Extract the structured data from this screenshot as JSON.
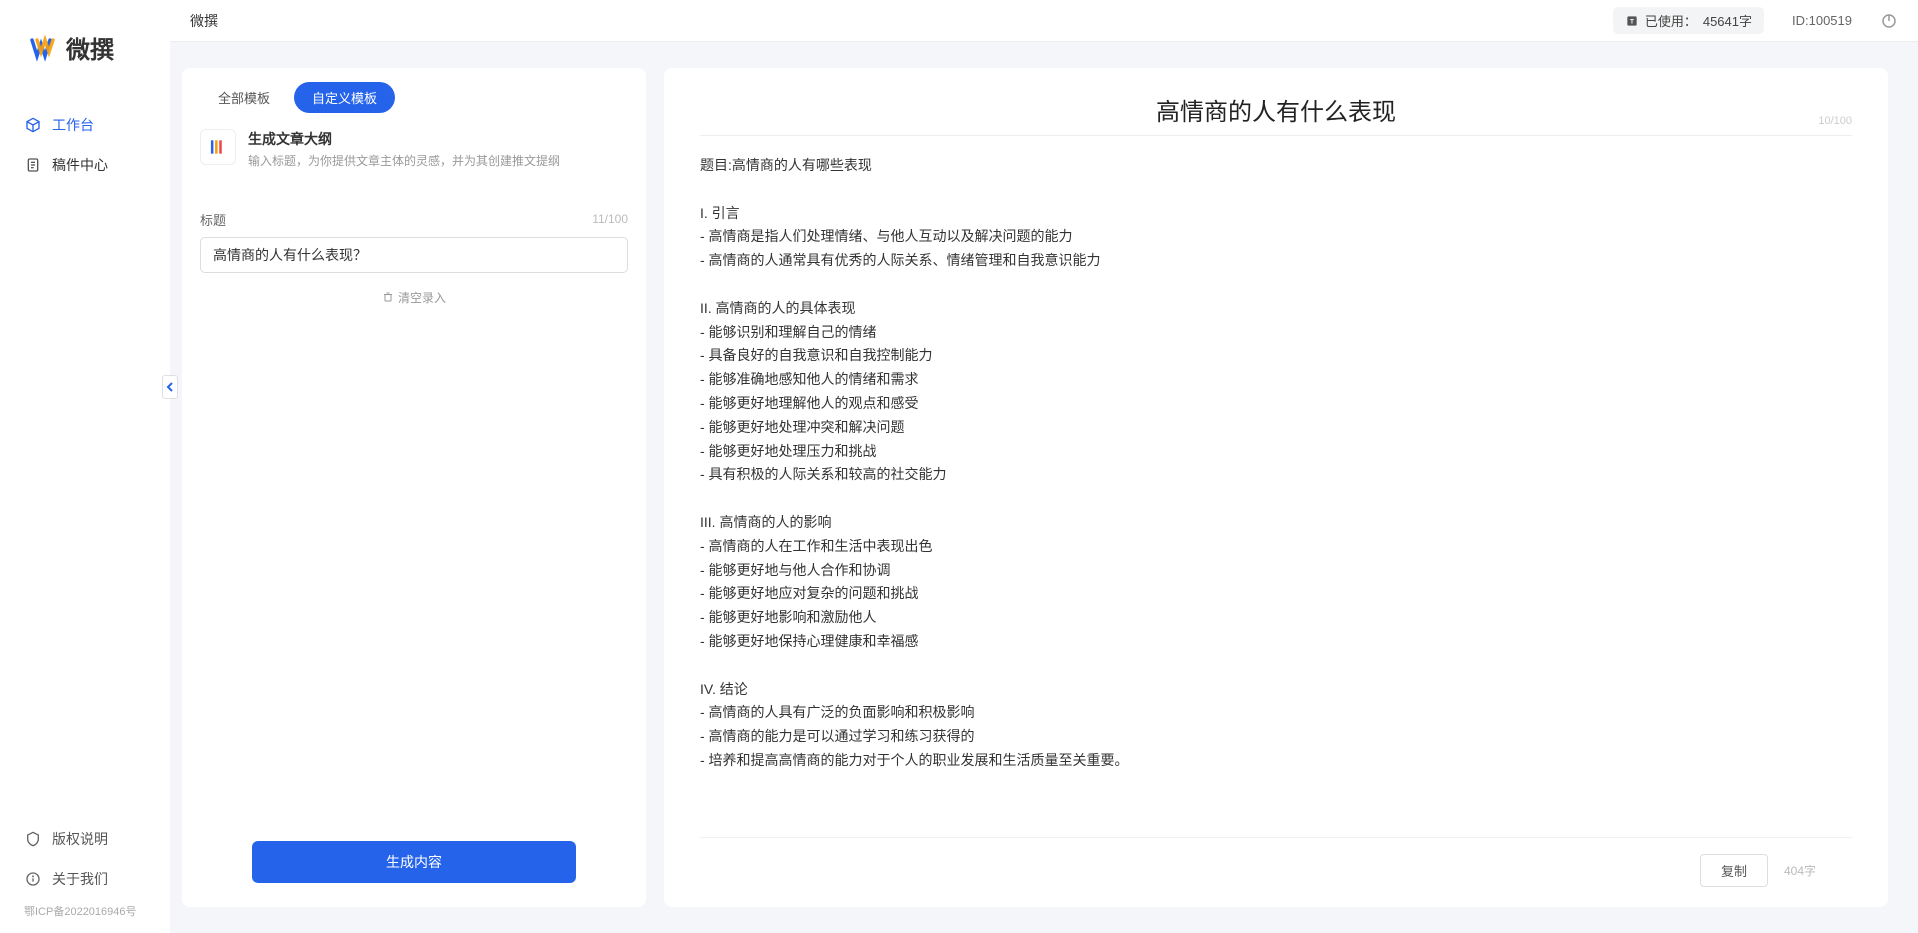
{
  "header": {
    "title": "微撰",
    "usage_prefix": "已使用：",
    "usage_value": "45641字",
    "id_label": "ID:100519"
  },
  "sidebar": {
    "logo_text": "微撰",
    "nav": [
      {
        "label": "工作台",
        "icon": "cube-icon",
        "active": true
      },
      {
        "label": "稿件中心",
        "icon": "document-icon",
        "active": false
      }
    ],
    "footer": [
      {
        "label": "版权说明",
        "icon": "shield-icon"
      },
      {
        "label": "关于我们",
        "icon": "info-icon"
      }
    ],
    "icp": "鄂ICP备2022016946号"
  },
  "left": {
    "tabs": [
      {
        "label": "全部模板",
        "active": false
      },
      {
        "label": "自定义模板",
        "active": true
      }
    ],
    "template": {
      "title": "生成文章大纲",
      "desc": "输入标题，为你提供文章主体的灵感，并为其创建推文提纲"
    },
    "field_label": "标题",
    "field_counter": "11/100",
    "input_value": "高情商的人有什么表现？",
    "clear_label": "清空录入",
    "generate_label": "生成内容"
  },
  "right": {
    "title": "高情商的人有什么表现",
    "title_counter": "10/100",
    "body": "题目:高情商的人有哪些表现\n\nI. 引言\n- 高情商是指人们处理情绪、与他人互动以及解决问题的能力\n- 高情商的人通常具有优秀的人际关系、情绪管理和自我意识能力\n\nII. 高情商的人的具体表现\n- 能够识别和理解自己的情绪\n- 具备良好的自我意识和自我控制能力\n- 能够准确地感知他人的情绪和需求\n- 能够更好地理解他人的观点和感受\n- 能够更好地处理冲突和解决问题\n- 能够更好地处理压力和挑战\n- 具有积极的人际关系和较高的社交能力\n\nIII. 高情商的人的影响\n- 高情商的人在工作和生活中表现出色\n- 能够更好地与他人合作和协调\n- 能够更好地应对复杂的问题和挑战\n- 能够更好地影响和激励他人\n- 能够更好地保持心理健康和幸福感\n\nIV. 结论\n- 高情商的人具有广泛的负面影响和积极影响\n- 高情商的能力是可以通过学习和练习获得的\n- 培养和提高高情商的能力对于个人的职业发展和生活质量至关重要。",
    "copy_label": "复制",
    "word_count": "404字"
  }
}
